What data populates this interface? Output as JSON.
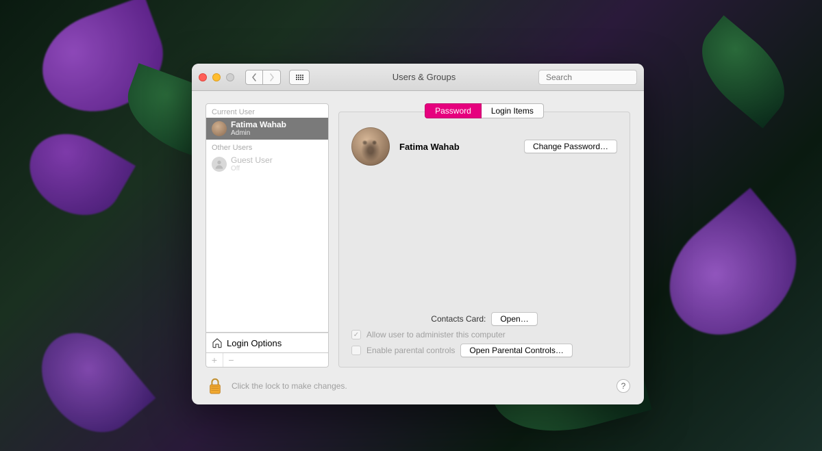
{
  "window": {
    "title": "Users & Groups"
  },
  "search": {
    "placeholder": "Search"
  },
  "sidebar": {
    "current_label": "Current User",
    "other_label": "Other Users",
    "current": {
      "name": "Fatima Wahab",
      "role": "Admin"
    },
    "others": [
      {
        "name": "Guest User",
        "role": "Off"
      }
    ],
    "login_options": "Login Options"
  },
  "tabs": {
    "password": "Password",
    "login_items": "Login Items"
  },
  "profile": {
    "name": "Fatima Wahab",
    "change_password": "Change Password…"
  },
  "contacts": {
    "label": "Contacts Card:",
    "button": "Open…"
  },
  "admin_check": "Allow user to administer this computer",
  "parental": {
    "label": "Enable parental controls",
    "button": "Open Parental Controls…"
  },
  "footer": {
    "lock_text": "Click the lock to make changes.",
    "help": "?"
  }
}
